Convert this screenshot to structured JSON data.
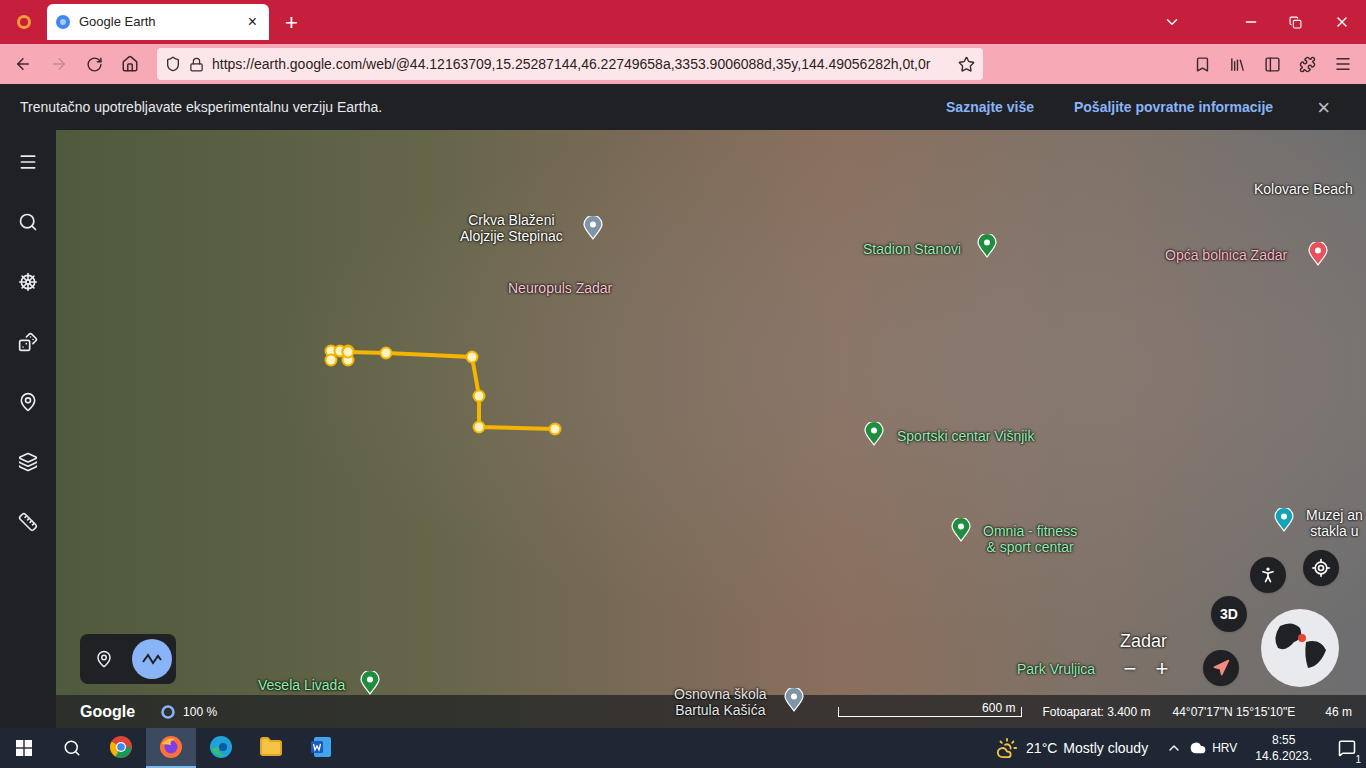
{
  "browser": {
    "tabs": [
      {
        "title": "Google Earth",
        "close": "×",
        "selected": true
      }
    ],
    "new_tab": "+",
    "url": "https://earth.google.com/web/@44.12163709,15.25287144,46.22749658a,3353.9006088d,35y,144.49056282h,0t,0r",
    "forward_disabled": true
  },
  "banner": {
    "text": "Trenutačno upotrebljavate eksperimentalnu verziju Eartha.",
    "links": [
      "Saznajte više",
      "Pošaljite povratne informacije"
    ],
    "close": "×"
  },
  "map": {
    "labels": [
      {
        "lines": [
          "Crkva Blaženi",
          "Alojzije Stepinac"
        ],
        "color": "#ffffff",
        "kind": "place",
        "pin_color": "#7e95a8"
      },
      {
        "lines": [
          "Neuropuls Zadar"
        ],
        "color": "#f9c4d4",
        "kind": "place"
      },
      {
        "lines": [
          "Stadion Stanovi"
        ],
        "color": "#8ff0b2",
        "kind": "place",
        "pin_color": "#1e8e3e"
      },
      {
        "lines": [
          "Kolovare Beach"
        ],
        "color": "#ffffff",
        "kind": "place"
      },
      {
        "lines": [
          "Opća bolnica Zadar"
        ],
        "color": "#ffb6c4",
        "kind": "place",
        "pin_color": "#e8505b"
      },
      {
        "lines": [
          "Sportski centar Višnjik"
        ],
        "color": "#8ff0b2",
        "kind": "place",
        "pin_color": "#1e8e3e"
      },
      {
        "lines": [
          "Omnia - fitness",
          "& sport centar"
        ],
        "color": "#8ff0b2",
        "kind": "place",
        "pin_color": "#1e8e3e"
      },
      {
        "lines": [
          "Muzej an",
          "stakla u"
        ],
        "color": "#ffffff",
        "kind": "place",
        "pin_color": "#12a4b4"
      },
      {
        "lines": [
          "Zadar"
        ],
        "color": "#ffffff",
        "kind": "city"
      },
      {
        "lines": [
          "Park Vruljica"
        ],
        "color": "#8ff0b2",
        "kind": "place"
      },
      {
        "lines": [
          "Vesela Livada"
        ],
        "color": "#8ff0b2",
        "kind": "place",
        "pin_color": "#1e8e3e"
      },
      {
        "lines": [
          "Osnovna škola",
          "Bartula Kašića"
        ],
        "color": "#e6e6e6",
        "kind": "place",
        "pin_color": "#7e95a8"
      }
    ]
  },
  "map_tools": [
    {
      "selected": false
    },
    {
      "selected": true
    }
  ],
  "controls": {
    "view_3d": "3D",
    "zoom_out": "−",
    "zoom_in": "+"
  },
  "status_bar": {
    "brand": "Google",
    "zoom": "100 %",
    "scale": "600 m",
    "camera": "Fotoaparat: 3.400 m",
    "coordinates": "44°07'17\"N 15°15'10\"E",
    "elevation": "46 m"
  },
  "taskbar": {
    "apps": [
      {
        "selected": false
      },
      {
        "selected": true
      },
      {
        "selected": false
      },
      {
        "selected": false
      },
      {
        "selected": false
      }
    ],
    "weather": {
      "temp": "21°C",
      "text": "Mostly cloudy"
    },
    "language": "HRV",
    "time": "8:55",
    "date": "14.6.2023.",
    "notifications": "1"
  }
}
